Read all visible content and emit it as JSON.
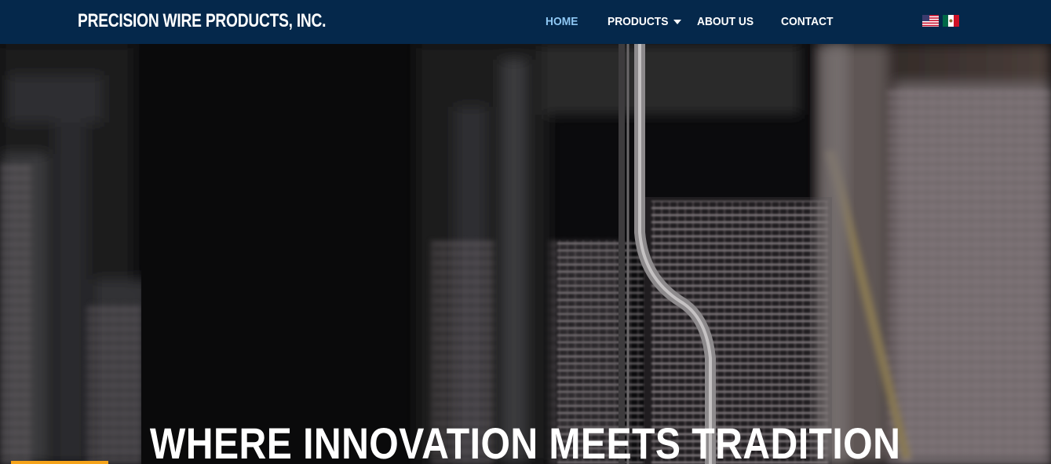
{
  "brand": {
    "name": "PRECISION WIRE PRODUCTS, INC."
  },
  "nav": {
    "items": [
      {
        "label": "HOME",
        "active": true
      },
      {
        "label": "PRODUCTS",
        "active": false,
        "has_dropdown": true
      },
      {
        "label": "ABOUT US",
        "active": false
      },
      {
        "label": "CONTACT",
        "active": false
      }
    ]
  },
  "languages": [
    {
      "icon": "us-flag-icon",
      "code": "en"
    },
    {
      "icon": "mexico-flag-icon",
      "code": "es"
    }
  ],
  "hero": {
    "headline": "WHERE INNOVATION MEETS TRADITION"
  },
  "colors": {
    "header_bg": "#05284b",
    "nav_active": "#8ec7f3",
    "accent": "#f5a31a",
    "text": "#ffffff"
  }
}
